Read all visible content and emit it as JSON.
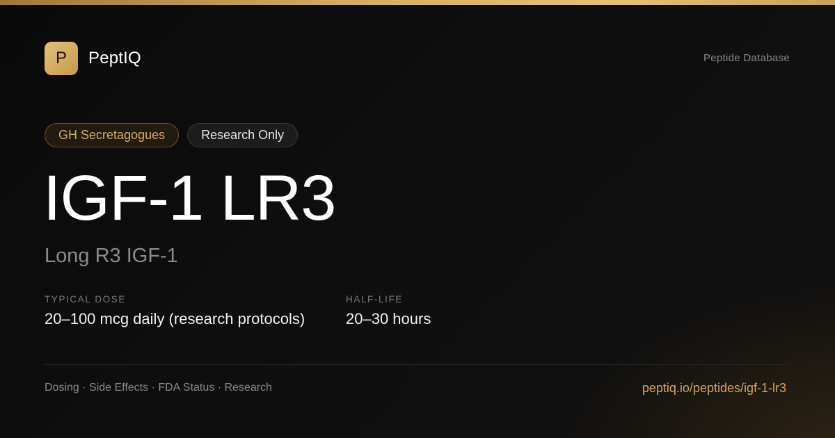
{
  "brand": {
    "logo_letter": "P",
    "name": "PeptIQ"
  },
  "header": {
    "section_label": "Peptide Database"
  },
  "badges": {
    "category": "GH Secretagogues",
    "status": "Research Only"
  },
  "peptide": {
    "name": "IGF-1 LR3",
    "full_name": "Long R3 IGF-1"
  },
  "stats": {
    "dose": {
      "label": "TYPICAL DOSE",
      "value": "20–100 mcg daily (research protocols)"
    },
    "half_life": {
      "label": "HALF-LIFE",
      "value": "20–30 hours"
    }
  },
  "footer": {
    "topics": "Dosing · Side Effects · FDA Status · Research",
    "url": "peptiq.io/peptides/igf-1-lr3"
  },
  "colors": {
    "accent_gold": "#d6a45a",
    "background": "#0b0b0c",
    "muted_text": "#8a8a8a"
  }
}
